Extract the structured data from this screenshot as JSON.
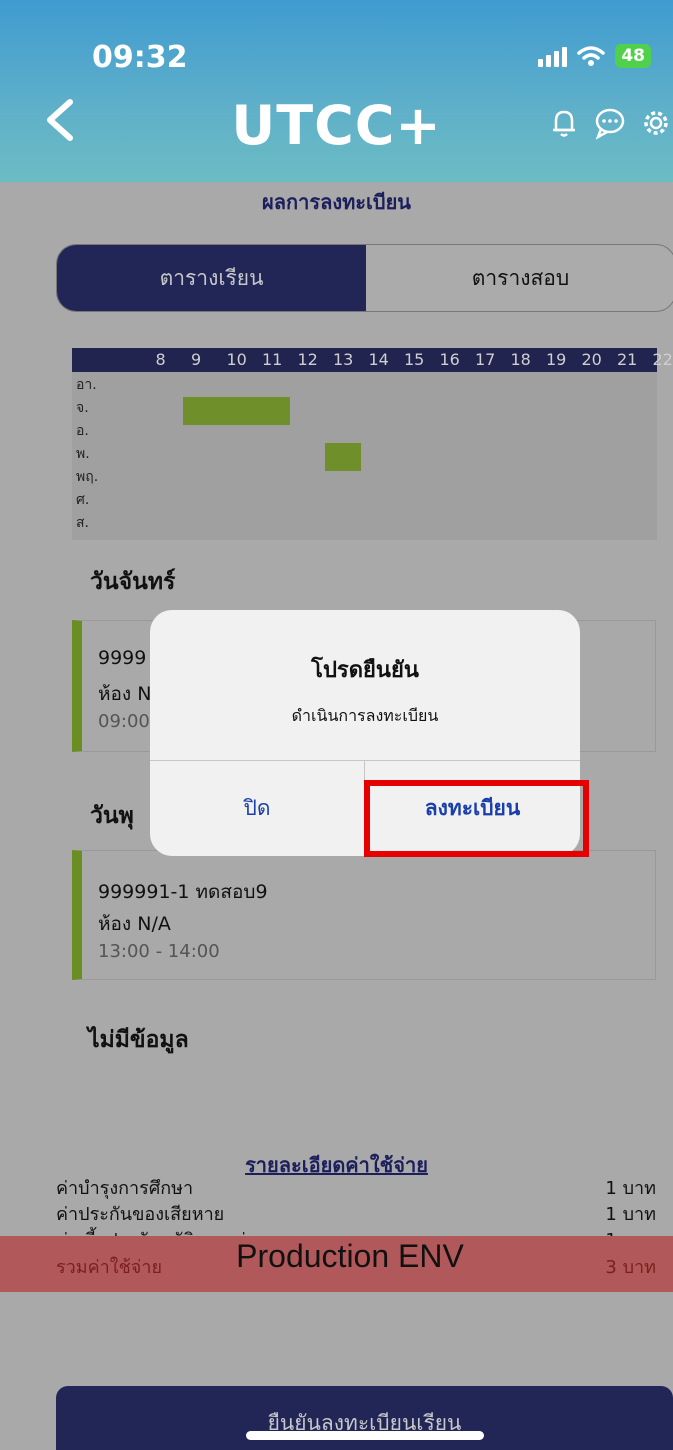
{
  "status_bar": {
    "time": "09:32",
    "battery": "48"
  },
  "header": {
    "title": "UTCC+",
    "icons": [
      "back-chevron-icon",
      "bell-icon",
      "chat-icon",
      "gear-icon"
    ]
  },
  "page": {
    "subtitle": "ผลการลงทะเบียน"
  },
  "tabs": [
    {
      "label": "ตารางเรียน",
      "active": true
    },
    {
      "label": "ตารางสอบ",
      "active": false
    }
  ],
  "timetable": {
    "hours": [
      "8",
      "9",
      "10",
      "11",
      "12",
      "13",
      "14",
      "15",
      "16",
      "17",
      "18",
      "19",
      "20",
      "21",
      "22"
    ],
    "days": [
      "อา.",
      "จ.",
      "อ.",
      "พ.",
      "พฤ.",
      "ศ.",
      "ส."
    ],
    "blocks": [
      {
        "day": "จ.",
        "start": 9,
        "end": 12
      },
      {
        "day": "พ.",
        "start": 13,
        "end": 14
      }
    ]
  },
  "schedule": [
    {
      "day": "วันจันทร์",
      "course": "9999",
      "room": "ห้อง N",
      "time": "09:00"
    },
    {
      "day": "วันพุ",
      "course": "999991-1 ทดสอบ9",
      "room": "ห้อง N/A",
      "time": "13:00 - 14:00"
    }
  ],
  "no_data_label": "ไม่มีข้อมูล",
  "costs": {
    "title": "รายละเอียดค่าใช้จ่าย",
    "items": [
      {
        "label": "ค่าบำรุงการศึกษา",
        "amount": "1 บาท"
      },
      {
        "label": "ค่าประกันของเสียหาย",
        "amount": "1 บาท"
      },
      {
        "label": "ค่าเบี้ยประกันอุบัติเหตุกลุ่ม",
        "amount": "1 บาท"
      }
    ],
    "total_label": "รวมค่าใช้จ่าย",
    "env_label": "Production ENV",
    "total_amount": "3 บาท"
  },
  "confirm_button": {
    "label": "ยืนยันลงทะเบียนเรียน"
  },
  "dialog": {
    "title": "โปรดยืนยัน",
    "message": "ดำเนินการลงทะเบียน",
    "close_label": "ปิด",
    "register_label": "ลงทะเบียน"
  },
  "colors": {
    "header_top": "#3f9bd0",
    "navy": "#222657",
    "class_block": "#6f8f2a",
    "highlight": "#e60000",
    "total_bar": "#b1595a"
  }
}
